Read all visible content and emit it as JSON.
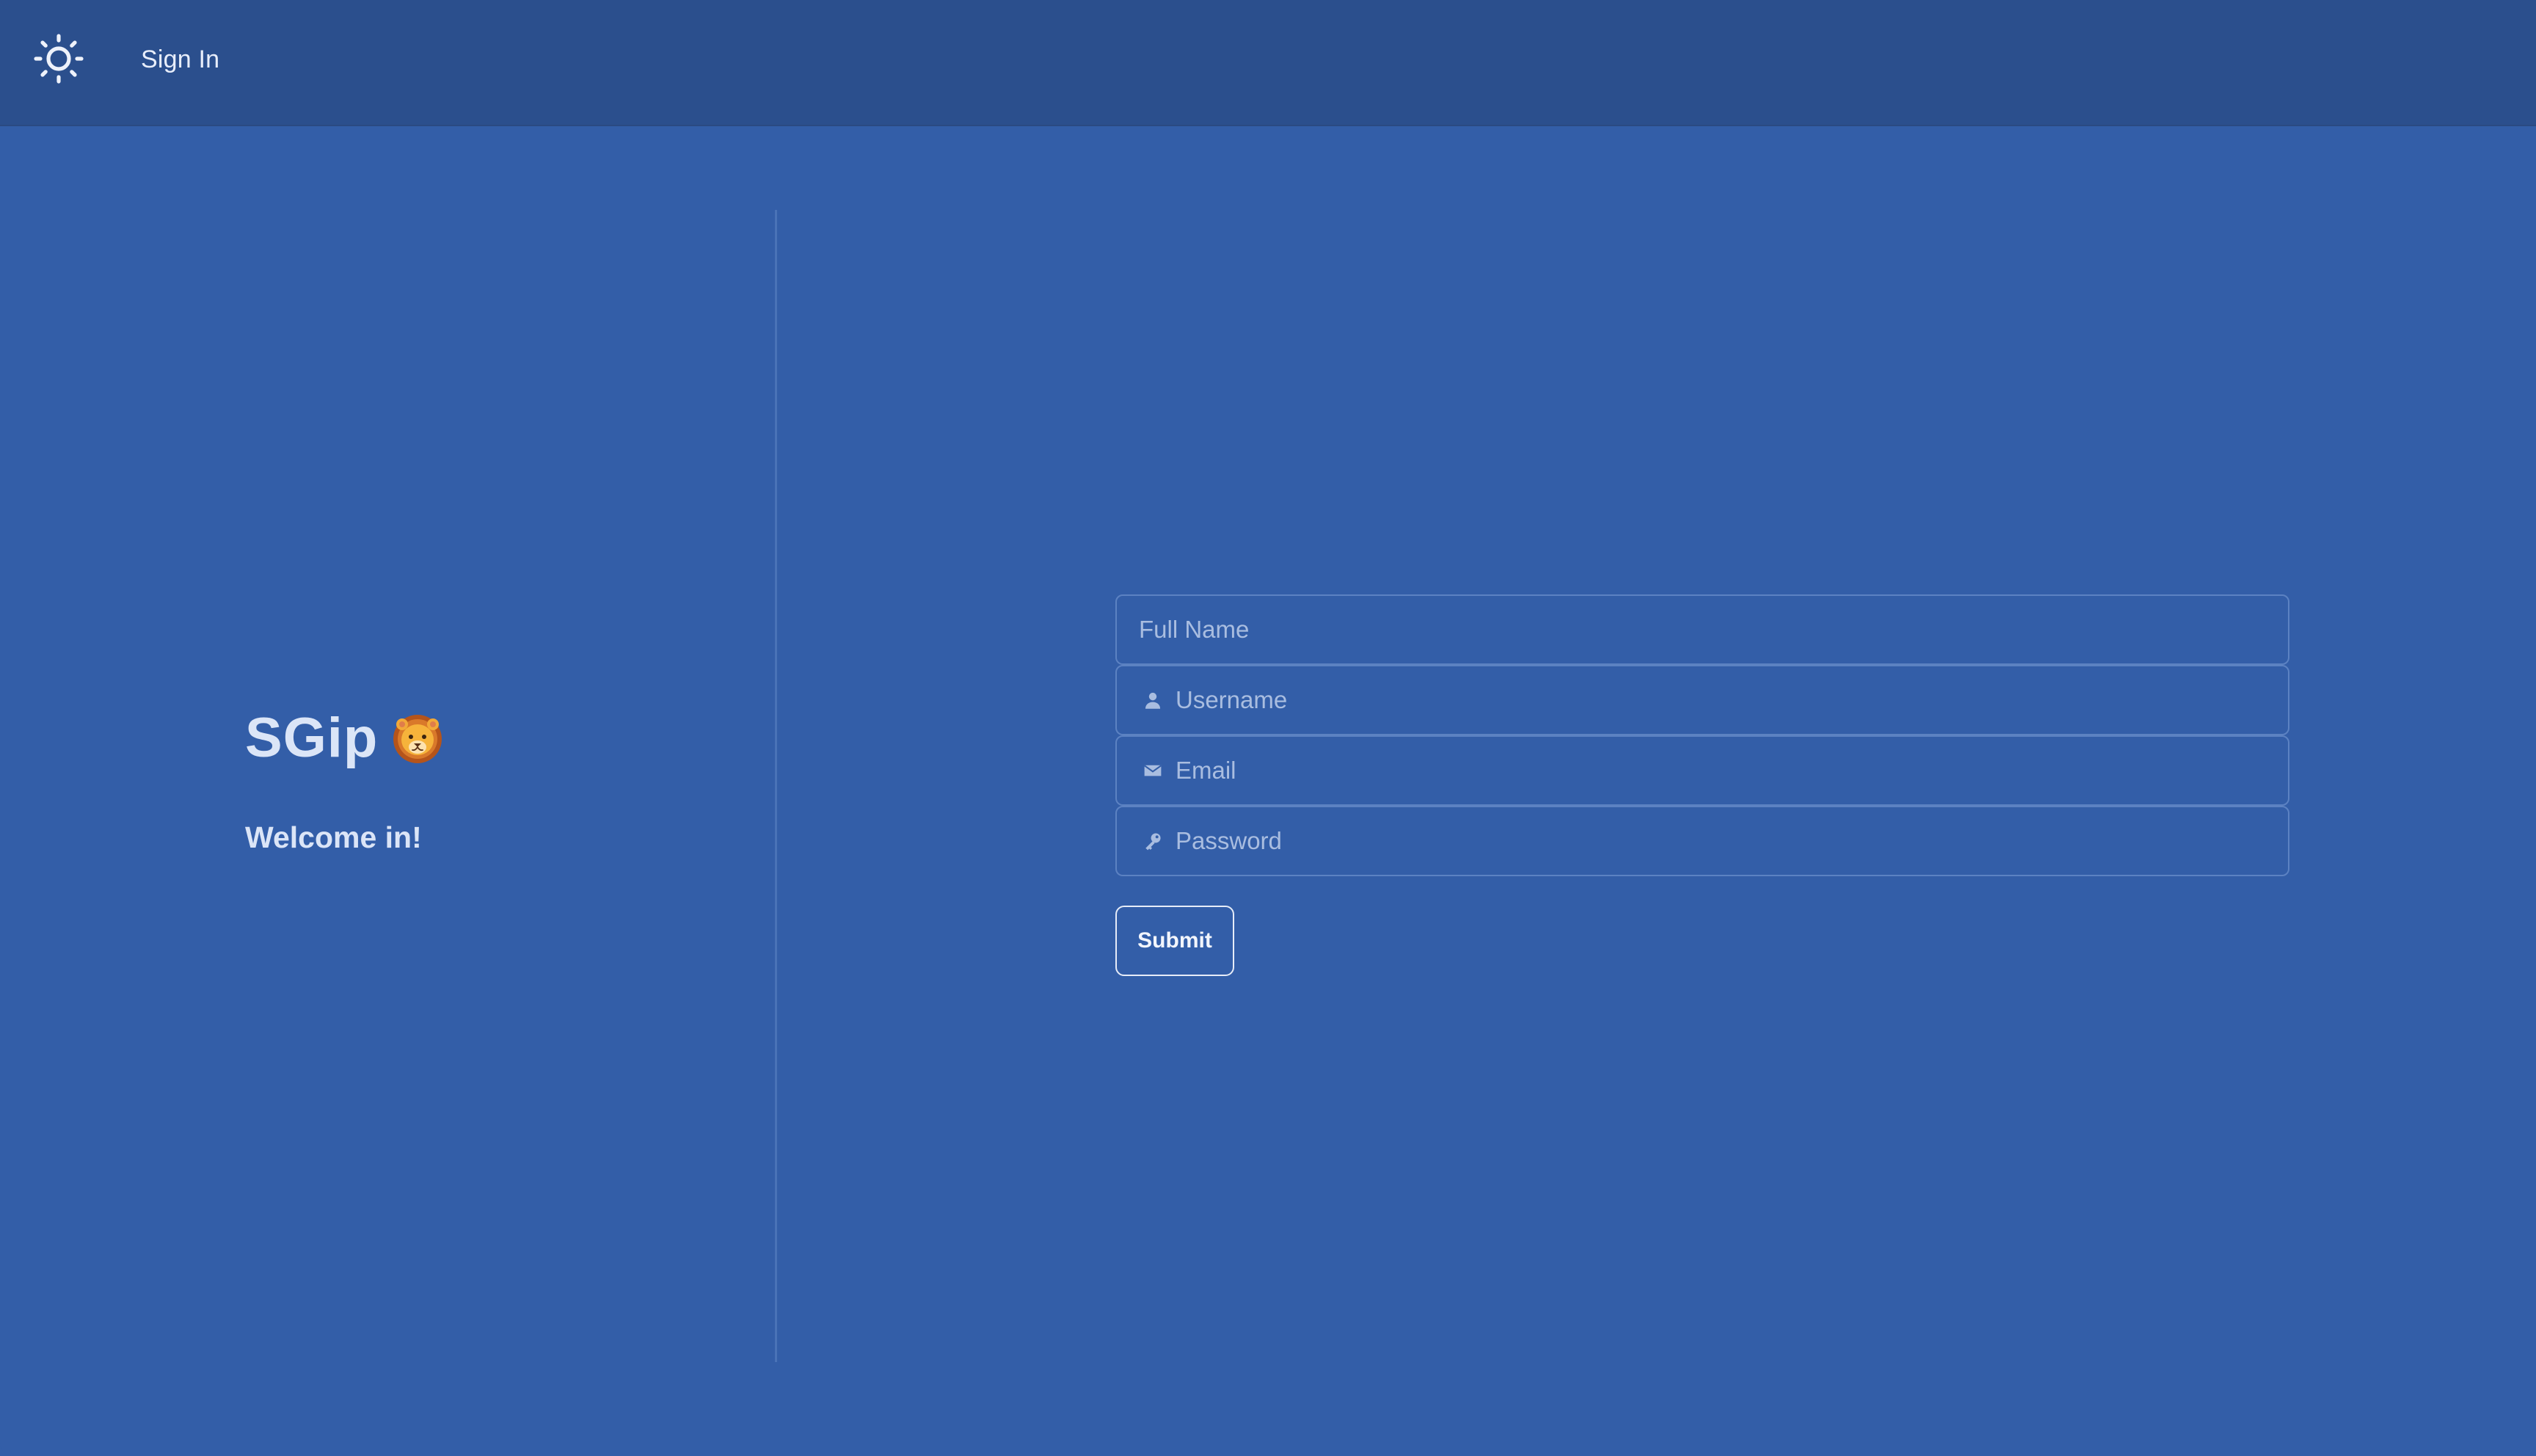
{
  "nav": {
    "theme_icon": "sun-icon",
    "signin_label": "Sign In"
  },
  "brand": {
    "title": "SGip",
    "emoji_icon": "lion-face-icon"
  },
  "welcome_text": "Welcome in!",
  "form": {
    "full_name": {
      "value": "",
      "placeholder": "Full Name"
    },
    "username": {
      "value": "",
      "placeholder": "Username",
      "icon": "user-icon"
    },
    "email": {
      "value": "",
      "placeholder": "Email",
      "icon": "mail-icon"
    },
    "password": {
      "value": "",
      "placeholder": "Password",
      "icon": "key-icon"
    },
    "submit_label": "Submit"
  },
  "colors": {
    "background": "#335ea8",
    "topbar": "#2b4f8d",
    "field_border": "#5c82c2",
    "text_light": "#dbe5f7"
  }
}
